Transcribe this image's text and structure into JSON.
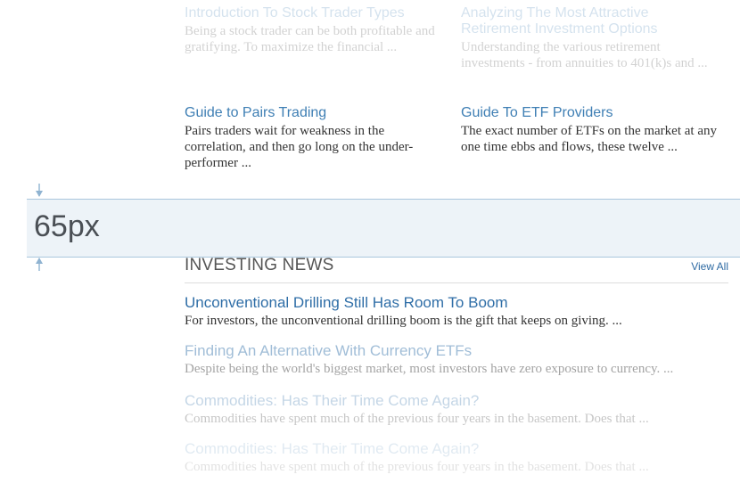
{
  "articles": [
    {
      "title": "Introduction To Stock Trader Types",
      "description": "Being a stock trader can be both profitable and gratifying. To maximize the financial ..."
    },
    {
      "title": "Analyzing The Most Attractive Retirement Investment Options",
      "description": "Understanding the various retirement investments - from annuities to 401(k)s and ..."
    },
    {
      "title": "Guide to Pairs Trading",
      "description": "Pairs traders wait for weakness in the correlation, and then go long on the under-performer ..."
    },
    {
      "title": "Guide To ETF Providers",
      "description": "The exact number of ETFs on the market at any one time ebbs and flows, these twelve ..."
    }
  ],
  "spacing_indicator": {
    "label": "65px",
    "accent_color": "#a9c6dd"
  },
  "news": {
    "heading": "INVESTING NEWS",
    "view_all_label": "View All",
    "items": [
      {
        "title": "Unconventional Drilling Still Has Room To Boom",
        "description": "For investors, the unconventional drilling boom is the gift that keeps on giving. ..."
      },
      {
        "title": "Finding An Alternative With Currency ETFs",
        "description": "Despite being the world's biggest market, most investors have zero exposure to currency. ..."
      },
      {
        "title": "Commodities: Has Their Time Come Again?",
        "description": "Commodities have spent much of the previous four years in the basement. Does that ..."
      },
      {
        "title": "Commodities: Has Their Time Come Again?",
        "description": "Commodities have spent much of the previous four years in the basement. Does that ..."
      }
    ]
  },
  "colors": {
    "link": "#3f7fb4",
    "body_text": "#333333",
    "heading": "#555555"
  }
}
